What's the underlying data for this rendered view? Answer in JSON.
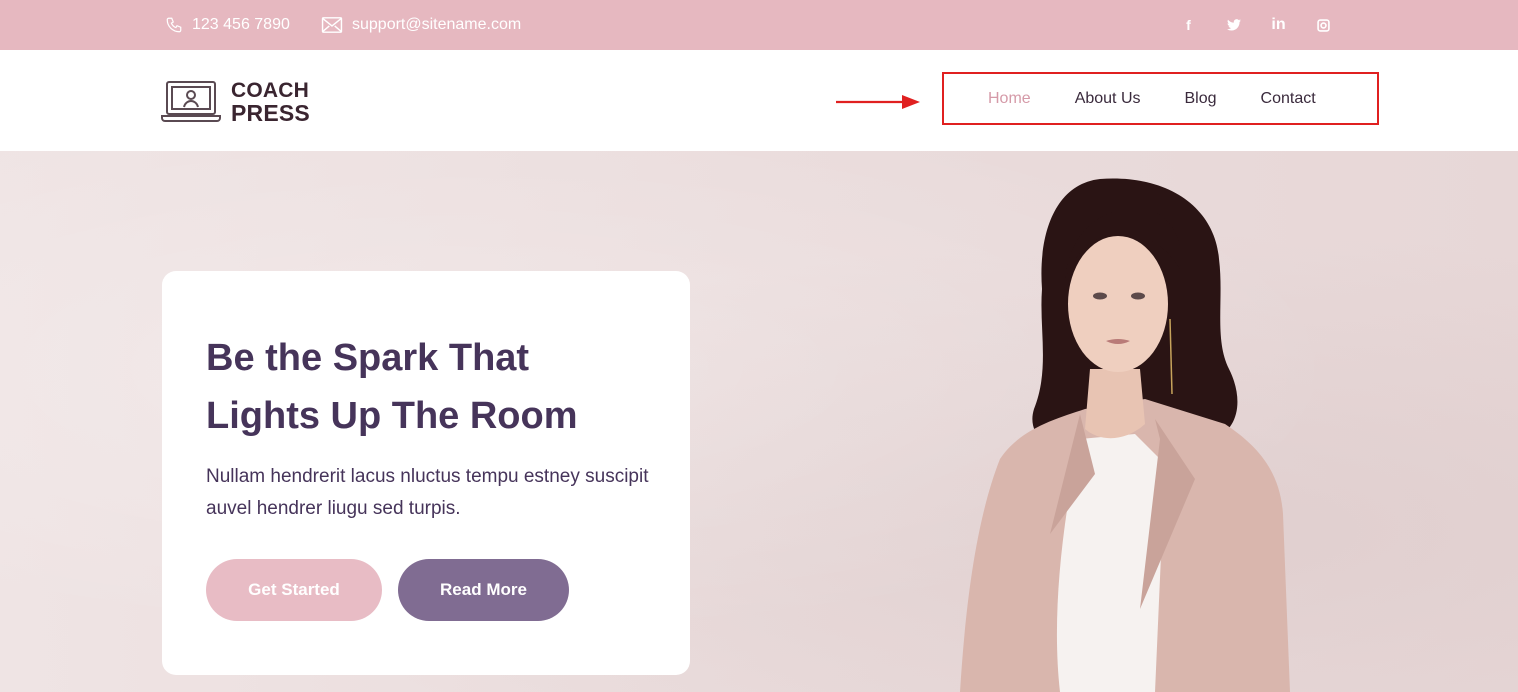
{
  "topbar": {
    "phone": "123 456 7890",
    "email": "support@sitename.com",
    "socials": [
      {
        "icon": "facebook-icon",
        "glyph": "f"
      },
      {
        "icon": "twitter-icon",
        "glyph": ""
      },
      {
        "icon": "linkedin-icon",
        "glyph": "in"
      },
      {
        "icon": "instagram-icon",
        "glyph": ""
      }
    ]
  },
  "logo": {
    "line1": "COACH",
    "line2": "PRESS"
  },
  "nav": {
    "items": [
      {
        "label": "Home",
        "active": true
      },
      {
        "label": "About Us",
        "active": false
      },
      {
        "label": "Blog",
        "active": false
      },
      {
        "label": "Contact",
        "active": false
      }
    ]
  },
  "hero": {
    "title": "Be the Spark That Lights Up The Room",
    "description": "Nullam hendrerit lacus nluctus tempu estney suscipit auvel hendrer liugu sed turpis.",
    "primary_button": "Get Started",
    "secondary_button": "Read More"
  },
  "colors": {
    "topbar": "#e6b8c0",
    "brand_dark": "#46345a",
    "nav_active": "#d59aa8",
    "button_primary": "#e8bcc5",
    "button_secondary": "#806c92",
    "annotation": "#e02020"
  }
}
